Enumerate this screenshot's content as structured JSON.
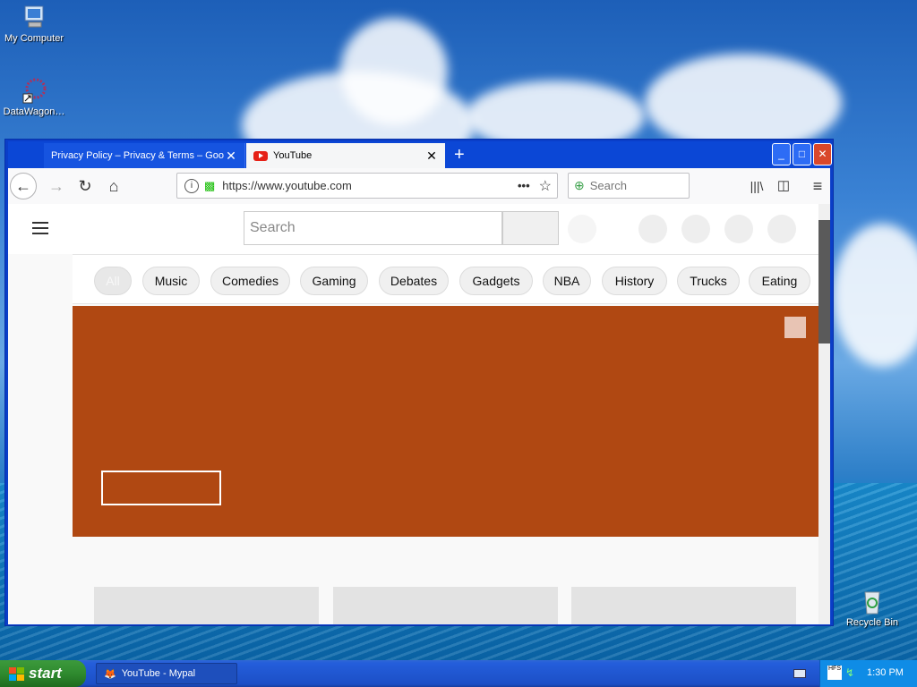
{
  "desktop": {
    "icons": [
      {
        "label": "My Computer",
        "icon": "computer-icon"
      },
      {
        "label": "DataWagon…",
        "icon": "network-shortcut-icon"
      },
      {
        "label": "Recycle Bin",
        "icon": "recycle-bin-icon"
      }
    ]
  },
  "browser": {
    "tabs": [
      {
        "title": "Privacy Policy – Privacy & Terms – Goo…",
        "close": "✕"
      },
      {
        "title": "YouTube",
        "close": "✕"
      }
    ],
    "new_tab": "+",
    "url": "https://www.youtube.com",
    "search_placeholder": "Search",
    "window_controls": [
      "_",
      "□",
      "✕"
    ]
  },
  "youtube": {
    "search_placeholder": "Search",
    "chips": [
      "All",
      "Music",
      "Comedies",
      "Gaming",
      "Debates",
      "Gadgets",
      "NBA",
      "History",
      "Trucks",
      "Eating"
    ]
  },
  "taskbar": {
    "start_label": "start",
    "task_label": "YouTube - Mypal",
    "clock": "1:30 PM"
  },
  "colors": {
    "banner": "#b04812",
    "titlebar": "#0b47d6"
  }
}
